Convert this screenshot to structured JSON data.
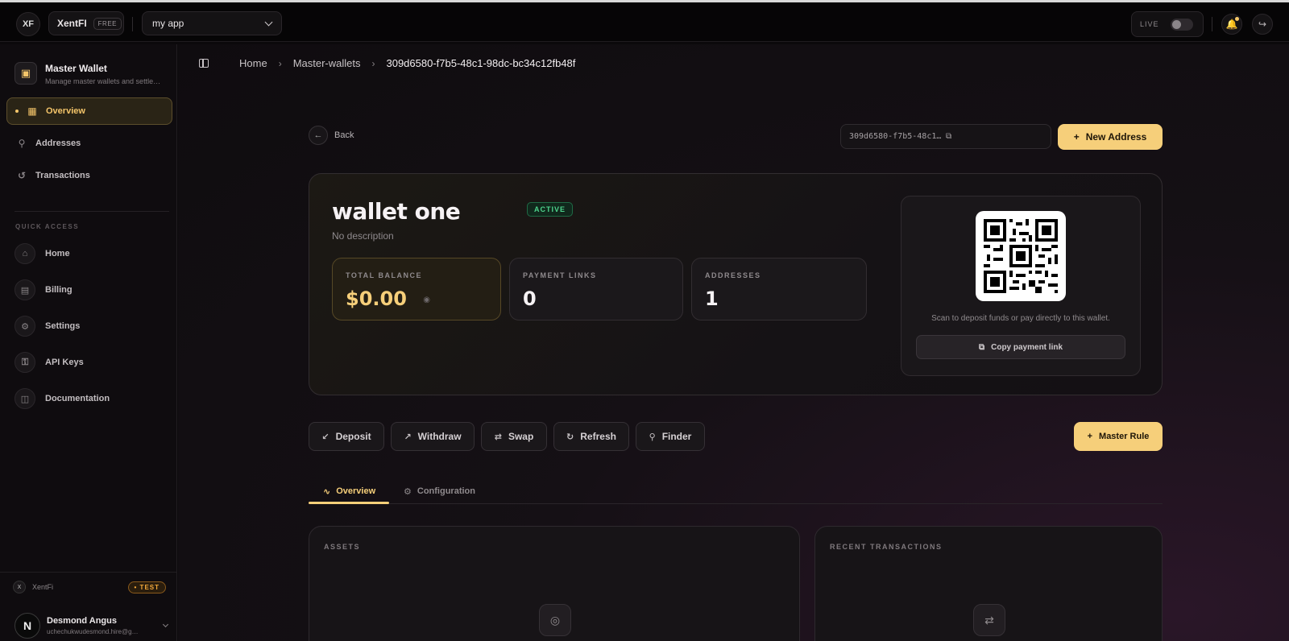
{
  "topbar": {
    "logo": "XF",
    "org_name": "XentFI",
    "plan_badge": "FREE",
    "app_select": "my app",
    "live_label": "LIVE"
  },
  "sidebar": {
    "header_title": "Master Wallet",
    "header_subtitle": "Manage master wallets and settlements",
    "items": [
      {
        "label": "Overview",
        "icon": "grid-icon"
      },
      {
        "label": "Addresses",
        "icon": "pin-icon"
      },
      {
        "label": "Transactions",
        "icon": "history-icon"
      }
    ],
    "quick_access_label": "QUICK ACCESS",
    "quick_access": [
      {
        "label": "Home",
        "icon": "home-icon"
      },
      {
        "label": "Billing",
        "icon": "card-icon"
      },
      {
        "label": "Settings",
        "icon": "gear-icon"
      },
      {
        "label": "API Keys",
        "icon": "key-icon"
      },
      {
        "label": "Documentation",
        "icon": "book-icon"
      }
    ],
    "env_name": "XentFi",
    "env_badge": "• TEST",
    "user": {
      "initial": "N",
      "name": "Desmond Angus",
      "email": "uchechukwudesmond.hire@gmail.com"
    }
  },
  "breadcrumb": [
    "Home",
    "Master-wallets",
    "309d6580-f7b5-48c1-98dc-bc34c12fb48f"
  ],
  "header": {
    "back_label": "Back",
    "wallet_id": "309d6580-f7b5-48c1-98dc-bc34c12fb48f",
    "new_address_label": "New Address"
  },
  "wallet": {
    "name": "wallet one",
    "status": "ACTIVE",
    "description": "No description",
    "stats": [
      {
        "label": "TOTAL BALANCE",
        "value": "$0.00"
      },
      {
        "label": "PAYMENT LINKS",
        "value": "0"
      },
      {
        "label": "ADDRESSES",
        "value": "1"
      }
    ],
    "qr_text": "Scan to deposit funds or pay directly to this wallet.",
    "copy_link_label": "Copy payment link"
  },
  "actions": [
    {
      "label": "Deposit",
      "icon": "arrow-down-left-icon"
    },
    {
      "label": "Withdraw",
      "icon": "arrow-up-right-icon"
    },
    {
      "label": "Swap",
      "icon": "swap-icon"
    },
    {
      "label": "Refresh",
      "icon": "refresh-icon"
    },
    {
      "label": "Finder",
      "icon": "search-icon"
    }
  ],
  "master_rule_label": "Master Rule",
  "tabs": [
    {
      "label": "Overview",
      "active": true
    },
    {
      "label": "Configuration",
      "active": false
    }
  ],
  "panels": {
    "assets_label": "ASSETS",
    "recent_label": "RECENT TRANSACTIONS"
  },
  "colors": {
    "accent": "#f6cf7a",
    "active_green": "#4ed38c",
    "background": "#0f0c0f"
  }
}
